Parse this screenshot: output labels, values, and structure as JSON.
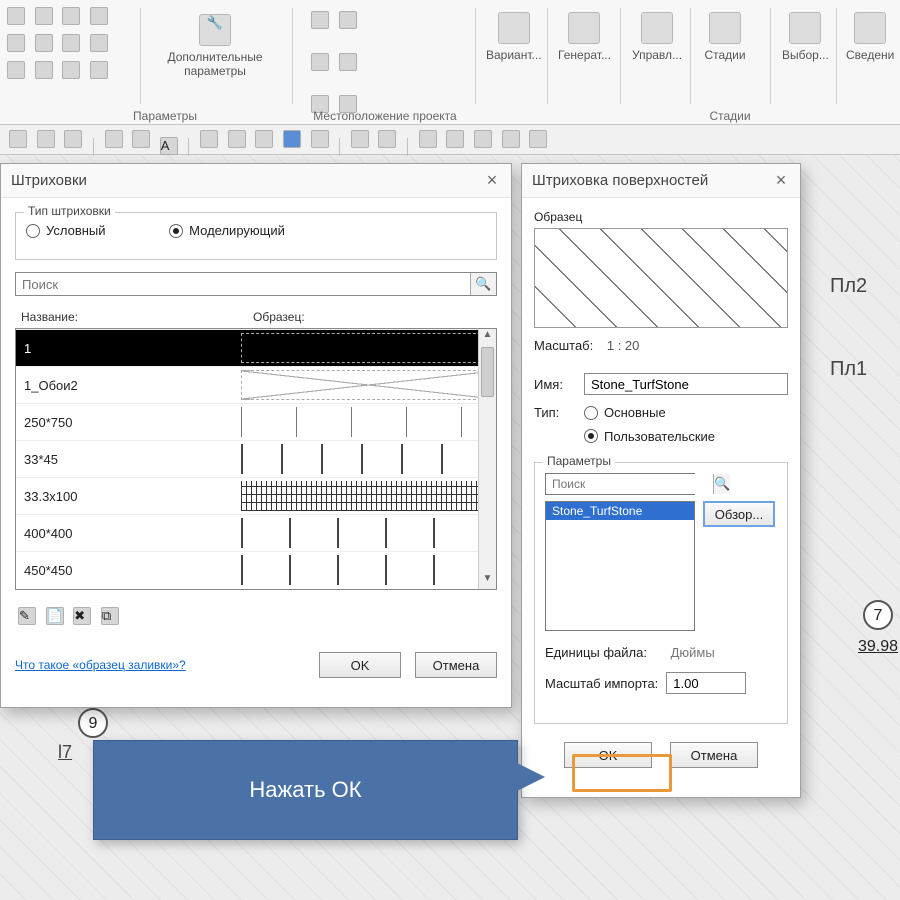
{
  "ribbon": {
    "group_params_caption": "Параметры",
    "extra_params_label": "Дополнительные\nпараметры",
    "group_location_caption": "Местоположение проекта",
    "stages_caption": "Стадии",
    "panels": {
      "variants": "Вариант...",
      "generate": "Генерат...",
      "manage": "Управл...",
      "stages": "Стадии",
      "select": "Выбор...",
      "info": "Сведени"
    }
  },
  "dlg1": {
    "title": "Штриховки",
    "type_group": "Тип штриховки",
    "radio_conditional": "Условный",
    "radio_model": "Моделирующий",
    "search_placeholder": "Поиск",
    "col_name": "Название:",
    "col_sample": "Образец:",
    "rows": [
      "1",
      "1_Обои2",
      "250*750",
      "33*45",
      "33.3х100",
      "400*400",
      "450*450"
    ],
    "link": "Что такое «образец заливки»?",
    "ok": "OK",
    "cancel": "Отмена"
  },
  "dlg2": {
    "title": "Штриховка поверхностей",
    "sample_label": "Образец",
    "scale_label": "Масштаб:",
    "scale_value": "1 : 20",
    "name_label": "Имя:",
    "name_value": "Stone_TurfStone",
    "type_label": "Тип:",
    "type_basic": "Основные",
    "type_custom": "Пользовательские",
    "params_label": "Параметры",
    "search_placeholder": "Поиск",
    "list_item": "Stone_TurfStone",
    "browse": "Обзор...",
    "units_label": "Единицы файла:",
    "units_value": "Дюймы",
    "import_scale_label": "Масштаб импорта:",
    "import_scale_value": "1.00",
    "ok": "OK",
    "cancel": "Отмена"
  },
  "callout_text": "Нажать ОК",
  "canvas": {
    "bubble7": "7",
    "bubble9": "9",
    "dim": "39.98",
    "pl1": "Пл1",
    "pl2": "Пл2",
    "l7": "l7"
  }
}
